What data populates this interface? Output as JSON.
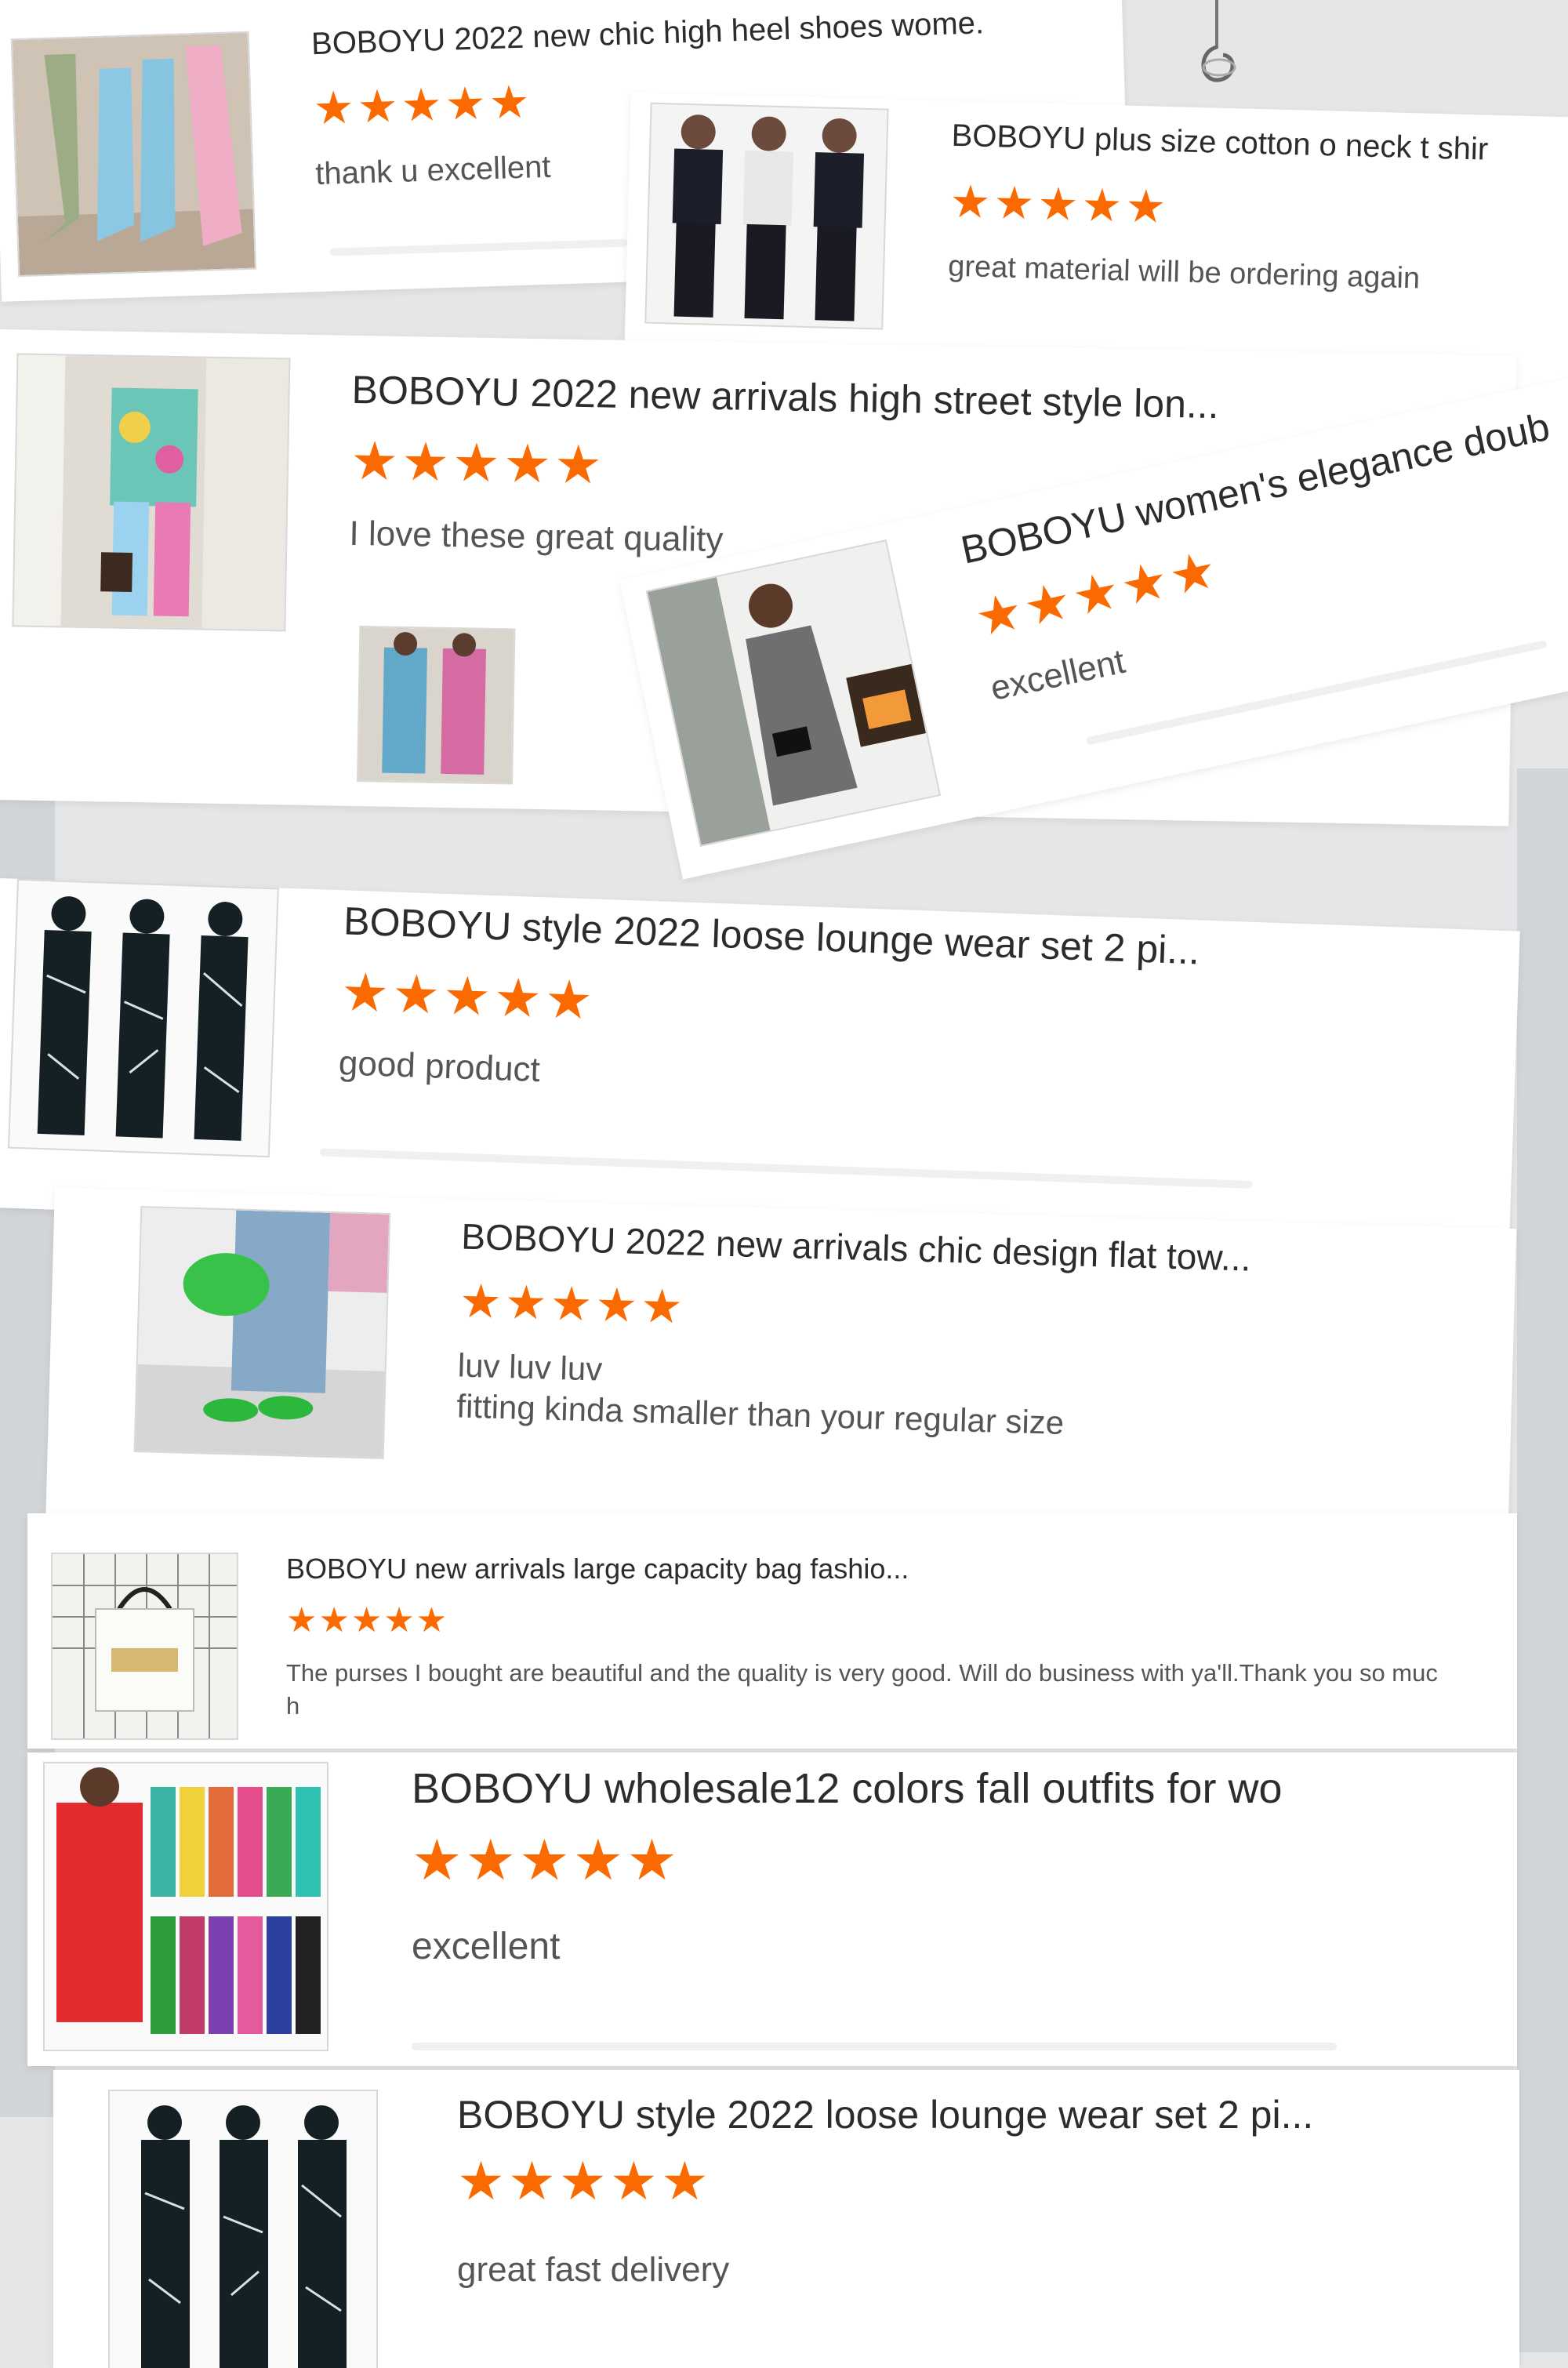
{
  "colors": {
    "star": "#fb6a00",
    "page_bg": "#e4e6e8"
  },
  "reviews": [
    {
      "title": "BOBOYU 2022 new chic high heel shoes wome.",
      "stars": "★★★★★",
      "comment": "thank u excellent",
      "image": "knee-high-boots"
    },
    {
      "title": "BOBOYU plus size cotton o neck t shir",
      "stars": "★★★★★",
      "comment": "great material will be ordering again",
      "image": "dope-tshirt-outfits"
    },
    {
      "title": "BOBOYU 2022 new arrivals high street style lon...",
      "stars": "★★★★★",
      "comment": "I love these great quality",
      "image": "graffiti-print-set"
    },
    {
      "title": "BOBOYU women's elegance doub",
      "stars": "★★★★★",
      "comment": "excellent",
      "image": "houndstooth-blazer-dress"
    },
    {
      "title": "BOBOYU style 2022 loose lounge wear set 2 pi...",
      "stars": "★★★★★",
      "comment": "good product",
      "image": "lounge-wear-set"
    },
    {
      "title": "BOBOYU 2022 new arrivals chic design flat tow...",
      "stars": "★★★★★",
      "comment": "luv luv luv",
      "comment2": "fitting kinda smaller than your regular size",
      "image": "green-flat-slides"
    },
    {
      "title": "BOBOYU new arrivals large capacity bag fashio...",
      "stars": "★★★★★",
      "comment": "The purses I bought are beautiful and the quality is very good.  Will do business with ya'll.Thank you so muc",
      "comment2": "h",
      "image": "large-tote-bag"
    },
    {
      "title": "BOBOYU wholesale12 colors fall outfits for wo",
      "stars": "★★★★★",
      "comment": "excellent",
      "image": "twelve-color-outfits"
    },
    {
      "title": "BOBOYU style 2022 loose lounge wear set 2 pi...",
      "stars": "★★★★★",
      "comment": "great fast delivery",
      "image": "lounge-wear-set"
    }
  ],
  "review3_extra_photo": "customer-photo-graffiti-set"
}
